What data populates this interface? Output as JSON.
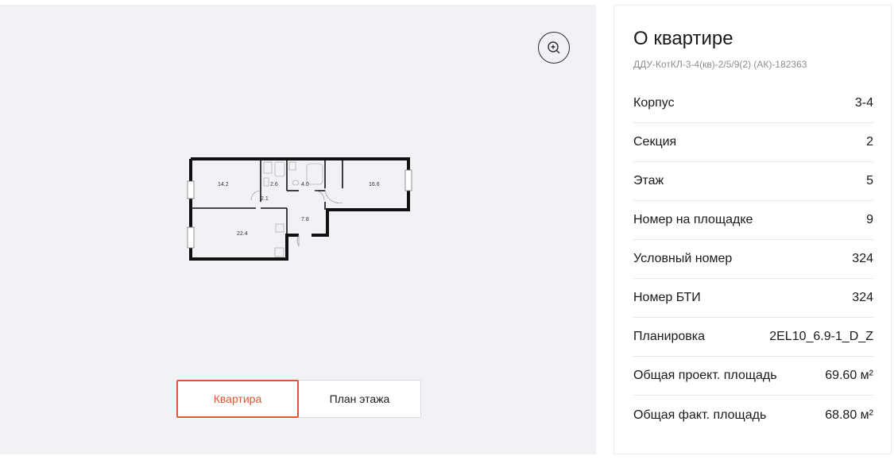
{
  "plan": {
    "zoom_icon": "zoom-in-icon",
    "rooms": [
      {
        "name": "room-14-2",
        "label": "14.2"
      },
      {
        "name": "room-2-6",
        "label": "2.6"
      },
      {
        "name": "room-4-0",
        "label": "4.0"
      },
      {
        "name": "room-16-6",
        "label": "16.6"
      },
      {
        "name": "room-2-1",
        "label": "2.1"
      },
      {
        "name": "room-7-8",
        "label": "7.8"
      },
      {
        "name": "room-22-4",
        "label": "22.4"
      }
    ]
  },
  "tabs": {
    "apartment": "Квартира",
    "floor_plan": "План этажа"
  },
  "info": {
    "title": "О квартире",
    "subtitle": "ДДУ-КотКЛ-3-4(кв)-2/5/9(2) (АК)-182363",
    "rows": [
      {
        "label": "Корпус",
        "value": "3-4"
      },
      {
        "label": "Секция",
        "value": "2"
      },
      {
        "label": "Этаж",
        "value": "5"
      },
      {
        "label": "Номер на площадке",
        "value": "9"
      },
      {
        "label": "Условный номер",
        "value": "324"
      },
      {
        "label": "Номер БТИ",
        "value": "324"
      },
      {
        "label": "Планировка",
        "value": "2EL10_6.9-1_D_Z"
      },
      {
        "label": "Общая проект. площадь",
        "value": "69.60 м²"
      },
      {
        "label": "Общая факт. площадь",
        "value": "68.80 м²"
      }
    ]
  },
  "colors": {
    "accent": "#e8542d",
    "panel_bg": "#f1f2f6"
  }
}
